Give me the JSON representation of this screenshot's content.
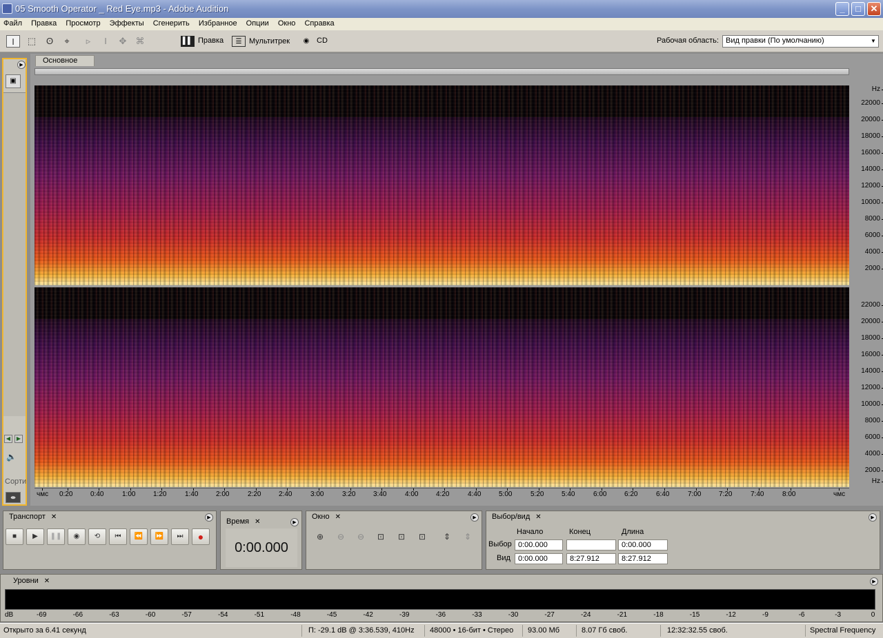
{
  "window": {
    "title": "05 Smooth Operator _ Red Eye.mp3 - Adobe Audition",
    "minimize": "_",
    "maximize": "□",
    "close": "✕"
  },
  "menu": [
    "Файл",
    "Правка",
    "Просмотр",
    "Эффекты",
    "Сгенерить",
    "Избранное",
    "Опции",
    "Окно",
    "Справка"
  ],
  "toolbar": {
    "views": [
      {
        "label": "Правка",
        "icon": "waveform-icon"
      },
      {
        "label": "Мультитрек",
        "icon": "multitrack-icon"
      },
      {
        "label": "CD",
        "icon": "cd-icon"
      }
    ],
    "workspace_label": "Рабочая область:",
    "workspace_value": "Вид правки (По умолчанию)"
  },
  "left_panel": {
    "sort_label": "Сорти"
  },
  "editor": {
    "tab": "Основное",
    "hz_labels": [
      "Hz",
      "22000",
      "20000",
      "18000",
      "16000",
      "14000",
      "12000",
      "10000",
      "8000",
      "6000",
      "4000",
      "2000"
    ],
    "hz_labels_bottom": [
      "22000",
      "20000",
      "18000",
      "16000",
      "14000",
      "12000",
      "10000",
      "8000",
      "6000",
      "4000",
      "2000",
      "Hz"
    ],
    "time_labels": [
      "чмс",
      "0:20",
      "0:40",
      "1:00",
      "1:20",
      "1:40",
      "2:00",
      "2:20",
      "2:40",
      "3:00",
      "3:20",
      "3:40",
      "4:00",
      "4:20",
      "4:40",
      "5:00",
      "5:20",
      "5:40",
      "6:00",
      "6:20",
      "6:40",
      "7:00",
      "7:20",
      "7:40",
      "8:00",
      "чмс"
    ],
    "colors": {
      "low": "#fff2b0",
      "mid": "#c92a2a",
      "high": "#3b0c4a"
    }
  },
  "transport": {
    "title": "Транспорт",
    "buttons": [
      "stop-icon",
      "play-icon",
      "pause-icon",
      "play-from-cursor-icon",
      "loop-icon",
      "go-start-icon",
      "rewind-icon",
      "fast-forward-icon",
      "go-end-icon",
      "record-icon"
    ]
  },
  "time": {
    "title": "Время",
    "value": "0:00.000"
  },
  "zoom": {
    "title": "Окно"
  },
  "selection": {
    "title": "Выбор/вид",
    "col_start": "Начало",
    "col_end": "Конец",
    "col_length": "Длина",
    "row_sel": "Выбор",
    "row_view": "Вид",
    "sel_start": "0:00.000",
    "sel_end": "",
    "sel_length": "0:00.000",
    "view_start": "0:00.000",
    "view_end": "8:27.912",
    "view_length": "8:27.912"
  },
  "levels": {
    "title": "Уровни",
    "scale": [
      "dB",
      "-69",
      "-66",
      "-63",
      "-60",
      "-57",
      "-54",
      "-51",
      "-48",
      "-45",
      "-42",
      "-39",
      "-36",
      "-33",
      "-30",
      "-27",
      "-24",
      "-21",
      "-18",
      "-15",
      "-12",
      "-9",
      "-6",
      "-3",
      "0"
    ]
  },
  "status": {
    "opened": "Открыто за 6.41 секунд",
    "cursor": "П: -29.1 dB @  3:36.539, 410Hz",
    "format": "48000 • 16-бит • Стерео",
    "size": "93.00 Мб",
    "free": "8.07 Гб своб.",
    "free_time": "12:32:32.55 своб.",
    "view_mode": "Spectral Frequency"
  }
}
